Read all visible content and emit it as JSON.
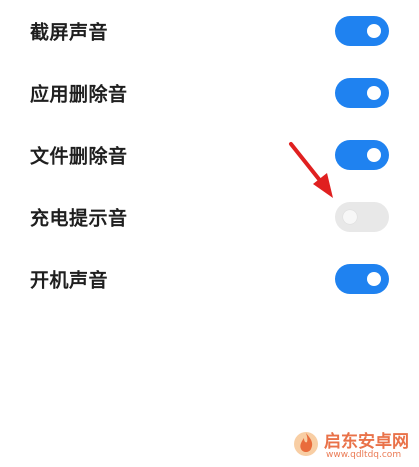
{
  "settings": {
    "items": [
      {
        "label": "截屏声音",
        "enabled": true
      },
      {
        "label": "应用删除音",
        "enabled": true
      },
      {
        "label": "文件删除音",
        "enabled": true
      },
      {
        "label": "充电提示音",
        "enabled": false
      },
      {
        "label": "开机声音",
        "enabled": true
      }
    ]
  },
  "colors": {
    "toggle_on": "#1f82f0",
    "toggle_off": "#e8e8e8",
    "arrow": "#e02020",
    "watermark": "#e65a2a"
  },
  "annotation": {
    "icon": "red-arrow-icon"
  },
  "watermark": {
    "title": "启东安卓网",
    "url": "www.qdltdq.com"
  }
}
